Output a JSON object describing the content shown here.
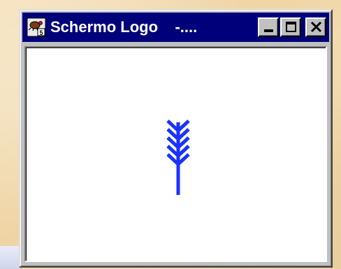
{
  "window": {
    "title": "Schermo Logo",
    "title_suffix": "-....",
    "app_icon": "logo-turtle-icon",
    "controls": {
      "minimize_icon": "minimize-icon",
      "maximize_icon": "maximize-icon",
      "close_icon": "close-icon"
    }
  },
  "canvas": {
    "drawing": "wheat-ear-logo-drawing",
    "stroke_color": "#1a33ff",
    "background_color": "#ffffff"
  },
  "colors": {
    "titlebar": "#00007b",
    "chrome": "#c0c0c0"
  }
}
